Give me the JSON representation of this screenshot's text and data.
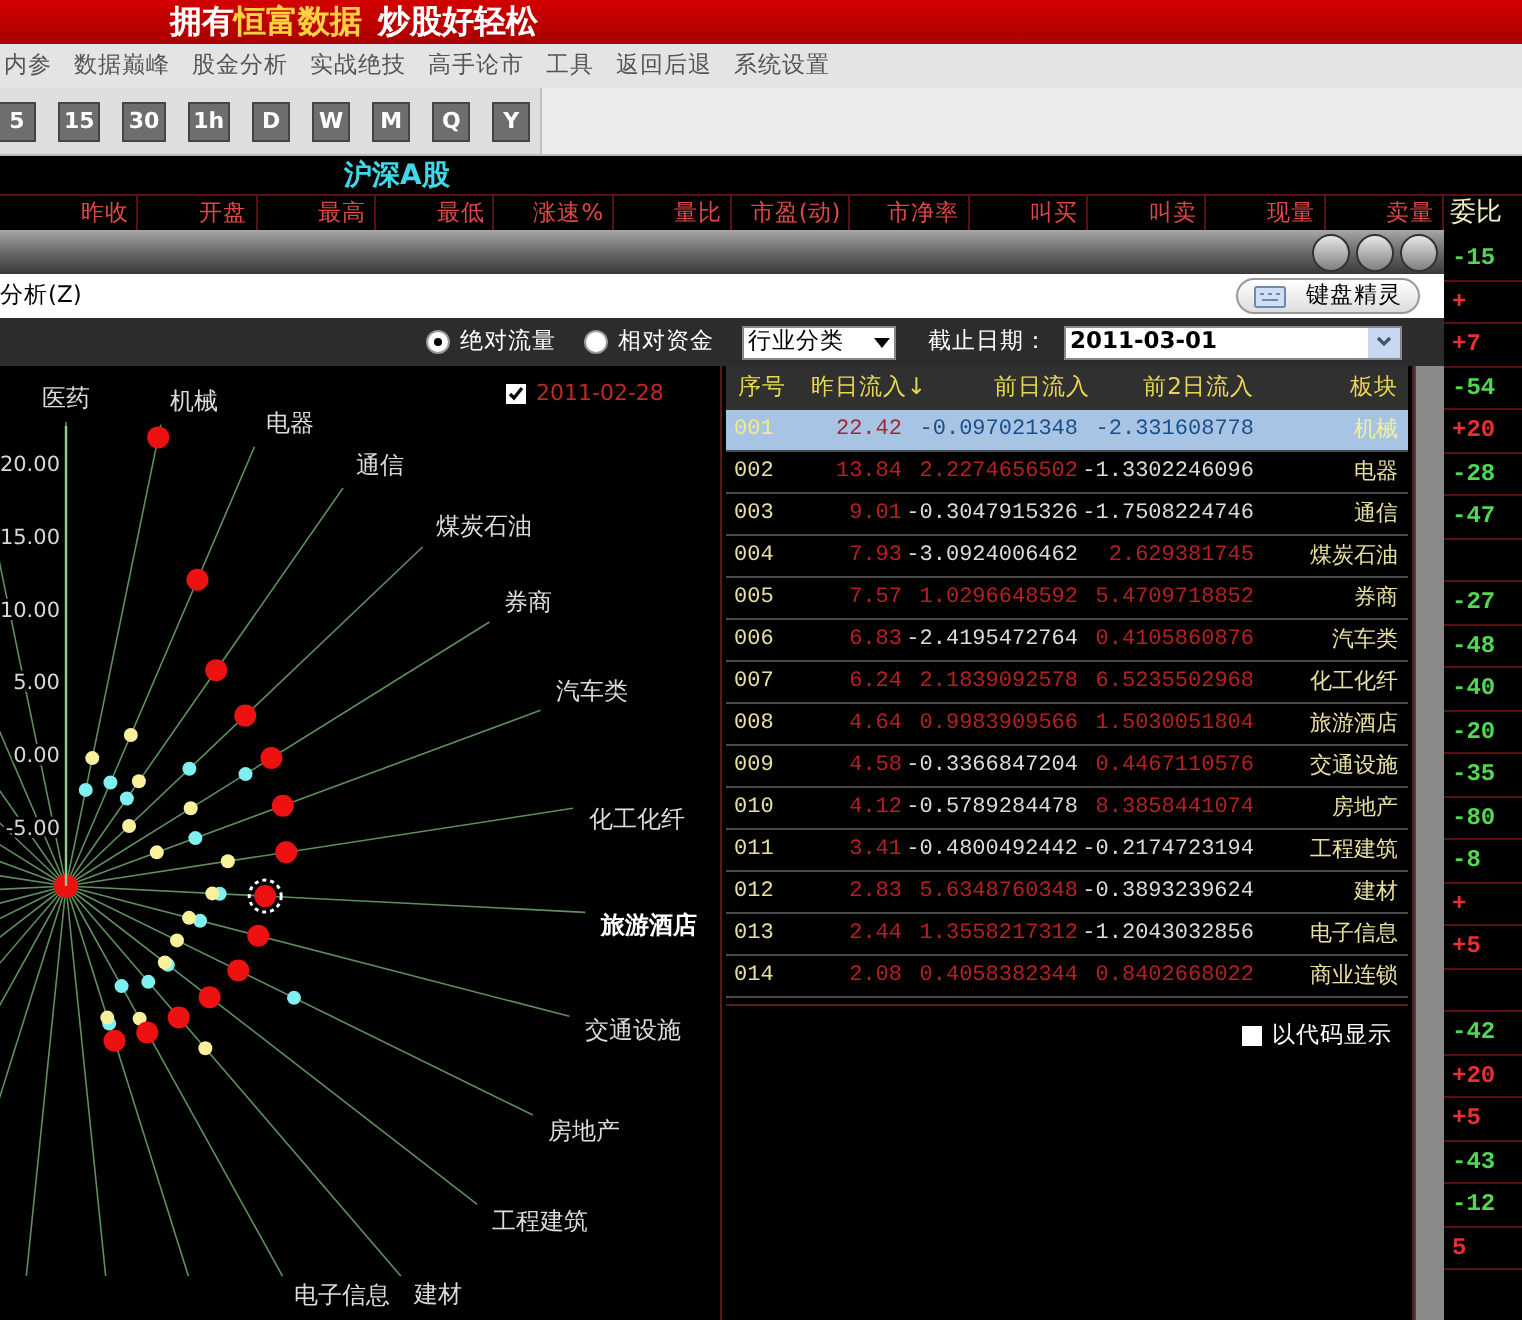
{
  "banner": {
    "parts": [
      {
        "text": "拥有",
        "highlight": false
      },
      {
        "text": "恒富数据",
        "highlight": true
      },
      {
        "text": "炒股好轻松",
        "highlight": false
      }
    ]
  },
  "menu": [
    "内参",
    "数据巅峰",
    "股金分析",
    "实战绝技",
    "高手论市",
    "工具",
    "返回后退",
    "系统设置"
  ],
  "periods": [
    "5",
    "15",
    "30",
    "1h",
    "D",
    "W",
    "M",
    "Q",
    "Y"
  ],
  "market_title": "沪深A股",
  "columns": [
    "昨收",
    "开盘",
    "最高",
    "最低",
    "涨速%",
    "量比",
    "市盈(动)",
    "市净率",
    "叫买",
    "叫卖",
    "现量",
    "卖量"
  ],
  "right_column": {
    "header": "委比",
    "values": [
      {
        "kind": "value",
        "text": "-15"
      },
      {
        "kind": "value",
        "text": "+"
      },
      {
        "kind": "value",
        "text": "+7"
      },
      {
        "kind": "value",
        "text": "-54"
      },
      {
        "kind": "value",
        "text": "+20"
      },
      {
        "kind": "value",
        "text": "-28"
      },
      {
        "kind": "value",
        "text": "-47"
      },
      {
        "kind": "blank"
      },
      {
        "kind": "value",
        "text": "-27"
      },
      {
        "kind": "value",
        "text": "-48"
      },
      {
        "kind": "value",
        "text": "-40"
      },
      {
        "kind": "value",
        "text": "-20"
      },
      {
        "kind": "value",
        "text": "-35"
      },
      {
        "kind": "value",
        "text": "-80"
      },
      {
        "kind": "value",
        "text": "-8"
      },
      {
        "kind": "value",
        "text": "+"
      },
      {
        "kind": "value",
        "text": "+5"
      },
      {
        "kind": "blank"
      },
      {
        "kind": "value",
        "text": "-42"
      },
      {
        "kind": "value",
        "text": "+20"
      },
      {
        "kind": "value",
        "text": "+5"
      },
      {
        "kind": "value",
        "text": "-43"
      },
      {
        "kind": "value",
        "text": "-12"
      },
      {
        "kind": "value",
        "text": "5"
      }
    ]
  },
  "dialog": {
    "menu": "分析(Z)",
    "keyboard_button": "键盘精灵",
    "modes": [
      {
        "label": "绝对流量",
        "selected": true
      },
      {
        "label": "相对资金",
        "selected": false
      }
    ],
    "category": "行业分类",
    "date_label": "截止日期：",
    "date": "2011-03-01",
    "chart": {
      "compare": {
        "checked": true,
        "date": "2011-02-28"
      },
      "ticks": [
        "20.00",
        "15.00",
        "10.00",
        "5.00",
        "0.00",
        "-5.00"
      ],
      "sectors": [
        {
          "label": "医药",
          "highlighted": false
        },
        {
          "label": "机械",
          "highlighted": false
        },
        {
          "label": "电器",
          "highlighted": false
        },
        {
          "label": "通信",
          "highlighted": false
        },
        {
          "label": "煤炭石油",
          "highlighted": false
        },
        {
          "label": "券商",
          "highlighted": false
        },
        {
          "label": "汽车类",
          "highlighted": false
        },
        {
          "label": "化工化纤",
          "highlighted": false
        },
        {
          "label": "旅游酒店",
          "highlighted": true
        },
        {
          "label": "交通设施",
          "highlighted": false
        },
        {
          "label": "房地产",
          "highlighted": false
        },
        {
          "label": "工程建筑",
          "highlighted": false
        },
        {
          "label": "建材",
          "highlighted": false
        },
        {
          "label": "电子信息",
          "highlighted": false
        }
      ]
    },
    "table": {
      "columns": [
        "序号",
        "昨日流入↓",
        "前日流入",
        "前2日流入",
        "板块"
      ],
      "rows": [
        {
          "no": "001",
          "d1": "22.42",
          "d2": "-0.097021348",
          "d3": "-2.331608778",
          "sector": "机械",
          "selected": true
        },
        {
          "no": "002",
          "d1": "13.84",
          "d2": "2.2274656502",
          "d3": "-1.3302246096",
          "sector": "电器",
          "selected": false
        },
        {
          "no": "003",
          "d1": "9.01",
          "d2": "-0.3047915326",
          "d3": "-1.7508224746",
          "sector": "通信",
          "selected": false
        },
        {
          "no": "004",
          "d1": "7.93",
          "d2": "-3.0924006462",
          "d3": "2.629381745",
          "sector": "煤炭石油",
          "selected": false
        },
        {
          "no": "005",
          "d1": "7.57",
          "d2": "1.0296648592",
          "d3": "5.4709718852",
          "sector": "券商",
          "selected": false
        },
        {
          "no": "006",
          "d1": "6.83",
          "d2": "-2.4195472764",
          "d3": "0.4105860876",
          "sector": "汽车类",
          "selected": false
        },
        {
          "no": "007",
          "d1": "6.24",
          "d2": "2.1839092578",
          "d3": "6.5235502968",
          "sector": "化工化纤",
          "selected": false
        },
        {
          "no": "008",
          "d1": "4.64",
          "d2": "0.9983909566",
          "d3": "1.5030051804",
          "sector": "旅游酒店",
          "selected": false
        },
        {
          "no": "009",
          "d1": "4.58",
          "d2": "-0.3366847204",
          "d3": "0.4467110576",
          "sector": "交通设施",
          "selected": false
        },
        {
          "no": "010",
          "d1": "4.12",
          "d2": "-0.5789284478",
          "d3": "8.3858441074",
          "sector": "房地产",
          "selected": false
        },
        {
          "no": "011",
          "d1": "3.41",
          "d2": "-0.4800492442",
          "d3": "-0.2174723194",
          "sector": "工程建筑",
          "selected": false
        },
        {
          "no": "012",
          "d1": "2.83",
          "d2": "5.6348760348",
          "d3": "-0.3893239624",
          "sector": "建材",
          "selected": false
        },
        {
          "no": "013",
          "d1": "2.44",
          "d2": "1.3558217312",
          "d3": "-1.2043032856",
          "sector": "电子信息",
          "selected": false
        },
        {
          "no": "014",
          "d1": "2.08",
          "d2": "0.4058382344",
          "d3": "0.8402668022",
          "sector": "商业连锁",
          "selected": false
        }
      ]
    },
    "show_code": {
      "label": "以代码显示",
      "checked": false
    }
  }
}
